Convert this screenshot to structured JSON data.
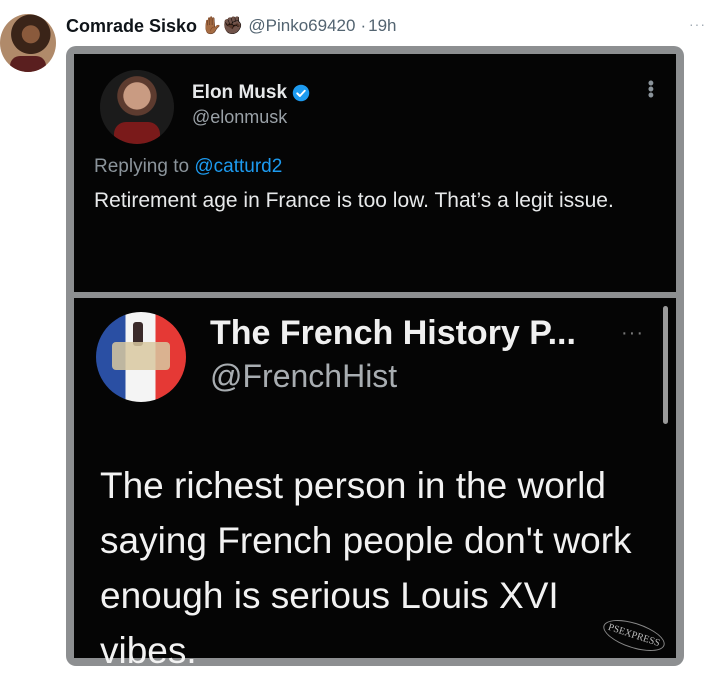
{
  "tweet": {
    "display_name": "Comrade Sisko",
    "emojis": "✋🏾✊🏿",
    "handle": "@Pinko69420",
    "separator": "·",
    "time": "19h",
    "more": "···"
  },
  "quoted_a": {
    "name": "Elon Musk",
    "handle": "@elonmusk",
    "replying_prefix": "Replying to",
    "replying_mention": "@catturd2",
    "text": "Retirement age in France is too low. That’s a legit issue.",
    "more": "⋮"
  },
  "quoted_b": {
    "name": "The French History P...",
    "handle": "@FrenchHist",
    "text": "The richest person in the world saying French people don't work enough is serious Louis XVI vibes.",
    "more": "···",
    "watermark": "PSEXPRESS"
  },
  "colors": {
    "link": "#1d9bf0",
    "verified": "#1d9bf0"
  }
}
